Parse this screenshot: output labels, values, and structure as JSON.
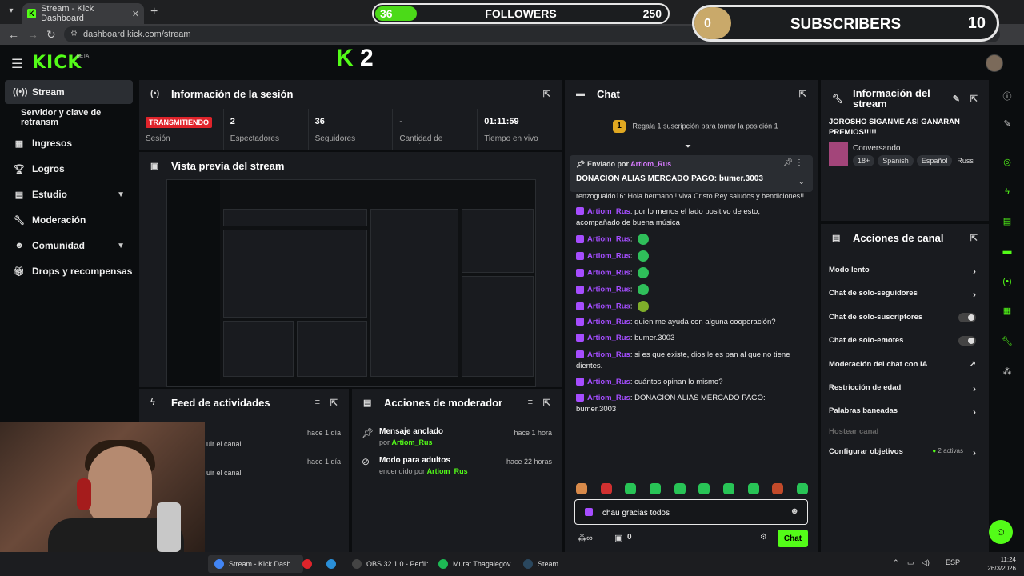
{
  "browser": {
    "tab_title": "Stream - Kick Dashboard",
    "url": "dashboard.kick.com/stream"
  },
  "overlays": {
    "followers": {
      "current": "36",
      "label": "FOLLOWERS",
      "goal": "250",
      "progress": 0.144
    },
    "subscribers": {
      "current": "0",
      "label": "SUBSCRIBERS",
      "goal": "10",
      "progress": 0.0
    }
  },
  "header": {
    "logo": "KICK",
    "beta": "BETA",
    "viewer_badge_count": "2"
  },
  "sidebar": {
    "items": [
      {
        "label": "Stream",
        "icon": "broadcast-icon",
        "active": true
      },
      {
        "label": "Servidor y clave de retransm"
      },
      {
        "label": "Ingresos",
        "icon": "chart-icon"
      },
      {
        "label": "Logros",
        "icon": "trophy-icon"
      },
      {
        "label": "Estudio",
        "icon": "studio-icon",
        "expand": true
      },
      {
        "label": "Moderación",
        "icon": "wrench-icon"
      },
      {
        "label": "Comunidad",
        "icon": "community-icon",
        "expand": true
      },
      {
        "label": "Drops y recompensas",
        "icon": "gift-icon"
      }
    ]
  },
  "session": {
    "title": "Información de la sesión",
    "cells": [
      {
        "value": "TRANSMITIENDO",
        "label": "Sesión"
      },
      {
        "value": "2",
        "label": "Espectadores"
      },
      {
        "value": "36",
        "label": "Seguidores"
      },
      {
        "value": "-",
        "label": "Cantidad de suscripciones"
      },
      {
        "value": "01:11:59",
        "label": "Tiempo en vivo"
      }
    ]
  },
  "preview": {
    "title": "Vista previa del stream"
  },
  "feed": {
    "title": "Feed de actividades",
    "rows": [
      {
        "time": "hace 1 día",
        "text": "uir el canal"
      },
      {
        "time": "hace 1 día",
        "text": "uir el canal"
      }
    ]
  },
  "mod_actions": {
    "title": "Acciones de moderador",
    "rows": [
      {
        "title": "Mensaje anclado",
        "sub_prefix": "por",
        "user": "Artiom_Rus",
        "time": "hace 1 hora"
      },
      {
        "title": "Modo para adultos",
        "sub_prefix": "encendido por",
        "user": "Artiom_Rus",
        "time": "hace 22 horas"
      }
    ]
  },
  "chat": {
    "title": "Chat",
    "gift_text": "Regala 1 suscripción para tomar la posición 1",
    "gift_rank": "1",
    "pinned": {
      "by_label": "Enviado por",
      "user": "Artiom_Rus",
      "message": "DONACION ALIAS MERCADO PAGO: bumer.3003"
    },
    "partial_line": "renzogualdo16: Hola hermano!! viva Cristo Rey saludos y bendiciones!!",
    "messages": [
      {
        "user": "Artiom_Rus",
        "text": "por lo menos el lado positivo de esto, acompañado de buena música"
      },
      {
        "user": "Artiom_Rus",
        "text": ""
      },
      {
        "user": "Artiom_Rus",
        "text": ""
      },
      {
        "user": "Artiom_Rus",
        "text": ""
      },
      {
        "user": "Artiom_Rus",
        "text": ""
      },
      {
        "user": "Artiom_Rus",
        "text": ""
      },
      {
        "user": "Artiom_Rus",
        "text": "quien me ayuda con alguna cooperación?"
      },
      {
        "user": "Artiom_Rus",
        "text": "bumer.3003"
      },
      {
        "user": "Artiom_Rus",
        "text": "si es que existe, dios le es pan al que no tiene dientes."
      },
      {
        "user": "Artiom_Rus",
        "text": "cuántos opinan lo mismo?"
      },
      {
        "user": "Artiom_Rus",
        "text": "DONACION ALIAS MERCADO PAGO: bumer.3003"
      }
    ],
    "input_value": "chau gracias todos",
    "points": "0",
    "send_label": "Chat"
  },
  "stream_info": {
    "title": "Información del stream",
    "stream_title": "JOROSHO SIGANME ASI GANARAN PREMIOS!!!!!",
    "category": "Conversando",
    "tags": [
      "18+",
      "Spanish",
      "Español",
      "Russ"
    ]
  },
  "channel_actions": {
    "title": "Acciones de canal",
    "rows": [
      {
        "label": "Modo lento",
        "control": "chevron"
      },
      {
        "label": "Chat de solo-seguidores",
        "control": "chevron"
      },
      {
        "label": "Chat de solo-suscriptores",
        "control": "toggle"
      },
      {
        "label": "Chat de solo-emotes",
        "control": "toggle"
      },
      {
        "label": "Moderación del chat con IA",
        "control": "external"
      },
      {
        "label": "Restricción de edad",
        "control": "chevron"
      },
      {
        "label": "Palabras baneadas",
        "control": "chevron"
      },
      {
        "label": "Hostear canal",
        "control": "none"
      },
      {
        "label": "Configurar objetivos",
        "control": "chevron",
        "note": "2 activas"
      }
    ]
  },
  "taskbar": {
    "apps": [
      {
        "label": "Stream - Kick Dash...",
        "color": "#4285f4"
      },
      {
        "label": "",
        "color": "#e0242b"
      },
      {
        "label": "",
        "color": "#2a8fd8"
      },
      {
        "label": "OBS 32.1.0 - Perfil: ...",
        "color": "#444444"
      },
      {
        "label": "Murat Thagalegov ...",
        "color": "#1db954"
      },
      {
        "label": "Steam",
        "color": "#2a475e"
      }
    ],
    "lang": "ESP",
    "time": "11:24",
    "date": "26/3/2026"
  },
  "colors": {
    "accent": "#53fc18",
    "live": "#e0242b",
    "username": "#a44dff"
  }
}
